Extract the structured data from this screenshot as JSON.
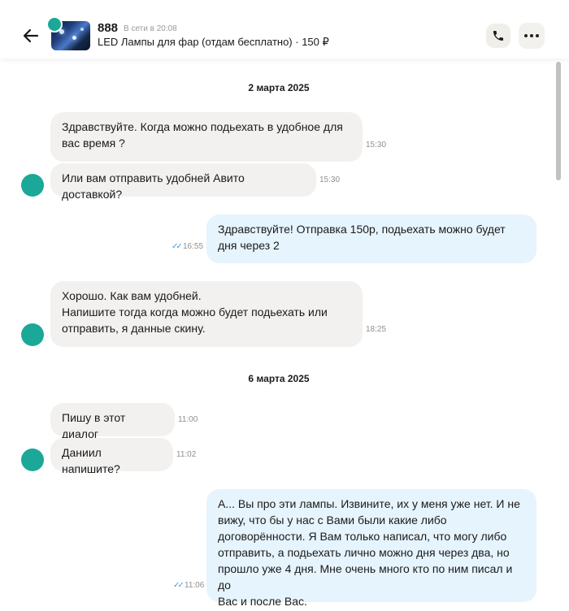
{
  "header": {
    "name": "888",
    "status": "В сети в 20:08",
    "item": "LED Лампы для фар (отдам бесплатно) · 150 ₽"
  },
  "colors": {
    "avatar": "#1ba898",
    "incoming": "#f2f1ef",
    "outgoing": "#e6f4fd",
    "read_ticks": "#3b9ef0"
  },
  "icons": {
    "back": "arrow-left-icon",
    "call": "phone-icon",
    "more": "more-dots-icon"
  },
  "dates": [
    "2 марта 2025",
    "6 марта 2025"
  ],
  "messages": [
    {
      "dir": "in",
      "lines": [
        "Здравствуйте. Когда можно подьехать в удобное для",
        "вас время ?"
      ],
      "time": "15:30"
    },
    {
      "dir": "in",
      "lines": [
        "Или вам отправить удобней Авито доставкой?"
      ],
      "time": "15:30"
    },
    {
      "dir": "out",
      "lines": [
        "Здравствуйте! Отправка 150р, подьехать можно будет",
        "дня через 2"
      ],
      "time": "16:55"
    },
    {
      "dir": "in",
      "lines": [
        "Хорошо. Как вам удобней.",
        "Напишите тогда когда можно будет подьехать  или",
        "отправить, я данные скину."
      ],
      "time": "18:25"
    },
    {
      "dir": "in",
      "lines": [
        "Пишу в этот диалог"
      ],
      "time": "11:00"
    },
    {
      "dir": "in",
      "lines": [
        "Даниил напишите?"
      ],
      "time": "11:02"
    },
    {
      "dir": "out",
      "lines": [
        "А... Вы про эти лампы. Извините, их у меня уже нет. И не",
        "вижу, что бы у нас с Вами были какие либо",
        "договорённости. Я Вам только написал, что могу либо",
        "отправить, а подьехать лично можно дня через два, но",
        "прошло уже 4 дня. Мне очень много кто по ним писал и до",
        "Вас и после Вас."
      ],
      "time": "11:06"
    }
  ]
}
